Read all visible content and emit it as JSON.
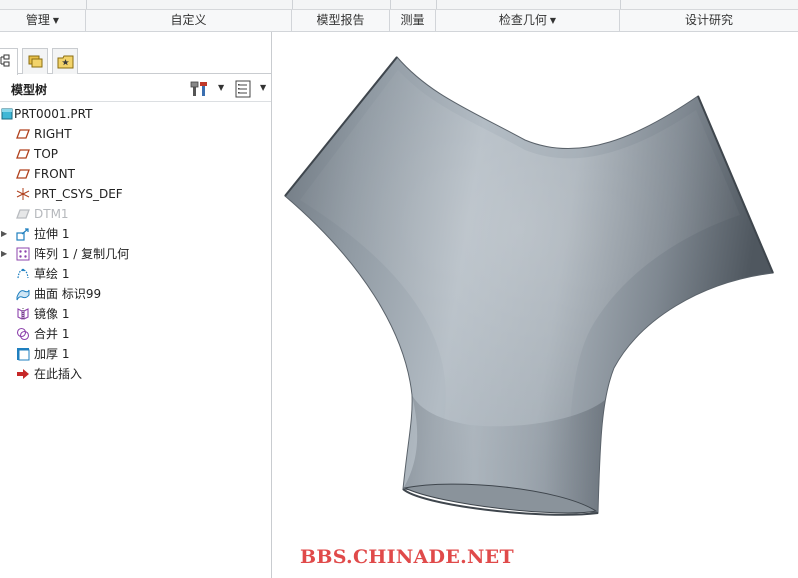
{
  "ribbon": {
    "groups": [
      {
        "label": "管理",
        "has_menu": true
      },
      {
        "label": "自定义",
        "has_menu": false
      },
      {
        "label": "模型报告",
        "has_menu": false
      },
      {
        "label": "测量",
        "has_menu": false
      },
      {
        "label": "检查几何",
        "has_menu": true
      },
      {
        "label": "设计研究",
        "has_menu": false
      }
    ]
  },
  "model_tree": {
    "title": "模型树",
    "root": "PRT0001.PRT",
    "items": [
      {
        "label": "RIGHT",
        "icon": "datum-plane-icon",
        "expandable": false,
        "dimmed": false
      },
      {
        "label": "TOP",
        "icon": "datum-plane-icon",
        "expandable": false,
        "dimmed": false
      },
      {
        "label": "FRONT",
        "icon": "datum-plane-icon",
        "expandable": false,
        "dimmed": false
      },
      {
        "label": "PRT_CSYS_DEF",
        "icon": "csys-icon",
        "expandable": false,
        "dimmed": false
      },
      {
        "label": "DTM1",
        "icon": "datum-plane-icon",
        "expandable": false,
        "dimmed": true
      },
      {
        "label": "拉伸 1",
        "icon": "extrude-icon",
        "expandable": true,
        "dimmed": false
      },
      {
        "label": "阵列 1 / 复制几何",
        "icon": "pattern-icon",
        "expandable": true,
        "dimmed": false
      },
      {
        "label": "草绘 1",
        "icon": "sketch-icon",
        "expandable": false,
        "dimmed": false
      },
      {
        "label": "曲面 标识99",
        "icon": "surface-icon",
        "expandable": false,
        "dimmed": false
      },
      {
        "label": "镜像 1",
        "icon": "mirror-icon",
        "expandable": false,
        "dimmed": false
      },
      {
        "label": "合并 1",
        "icon": "merge-icon",
        "expandable": false,
        "dimmed": false
      },
      {
        "label": "加厚 1",
        "icon": "thicken-icon",
        "expandable": false,
        "dimmed": false
      },
      {
        "label": "在此插入",
        "icon": "insert-here-icon",
        "expandable": false,
        "dimmed": false
      }
    ]
  },
  "watermark": "BBS.CHINADE.NET",
  "colors": {
    "accent": "#1f7fbf",
    "part_fill": "#a7b0b8",
    "watermark": "#e04a4a",
    "insert_arrow": "#c62828"
  }
}
